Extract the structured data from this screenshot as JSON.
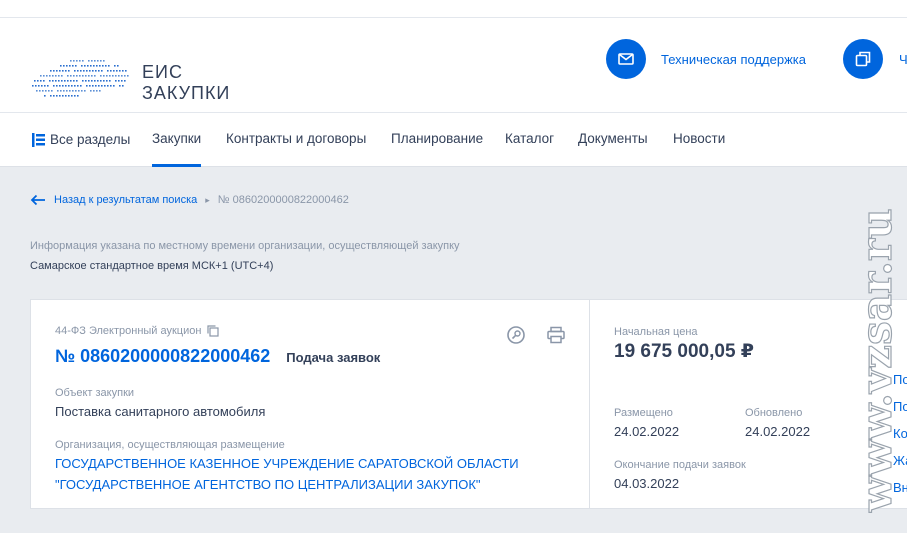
{
  "header": {
    "logo_line1": "ЕИС",
    "logo_line2": "ЗАКУПКИ",
    "support_label": "Техническая поддержка",
    "second_action_label": "Ч"
  },
  "nav": {
    "items": [
      {
        "label": "Все разделы"
      },
      {
        "label": "Закупки"
      },
      {
        "label": "Контракты и договоры"
      },
      {
        "label": "Планирование"
      },
      {
        "label": "Каталог"
      },
      {
        "label": "Документы"
      },
      {
        "label": "Новости"
      }
    ],
    "active_index": 1
  },
  "breadcrumb": {
    "back_label": "Назад к результатам поиска",
    "current": "№ 0860200000822000462"
  },
  "timezone": {
    "note": "Информация указана по местному времени организации, осуществляющей закупку",
    "value": "Самарское стандартное время МСК+1 (UTC+4)"
  },
  "purchase": {
    "law_type": "44-ФЗ Электронный аукцион",
    "reg_number": "№ 0860200000822000462",
    "stage": "Подача заявок",
    "object_label": "Объект закупки",
    "object_value": "Поставка  санитарного автомобиля",
    "org_label": "Организация, осуществляющая размещение",
    "org_line1": "ГОСУДАРСТВЕННОЕ КАЗЕННОЕ УЧРЕЖДЕНИЕ САРАТОВСКОЙ ОБЛАСТИ",
    "org_line2": "\"ГОСУДАРСТВЕННОЕ АГЕНТСТВО ПО ЦЕНТРАЛИЗАЦИИ ЗАКУПОК\""
  },
  "price_block": {
    "price_label": "Начальная цена",
    "price_value": "19 675 000,05 ₽",
    "posted_label": "Размещено",
    "posted_value": "24.02.2022",
    "updated_label": "Обновлено",
    "updated_value": "24.02.2022",
    "deadline_label": "Окончание подачи заявок",
    "deadline_value": "04.03.2022"
  },
  "side_links": [
    "По",
    "По",
    "Ко",
    "Жа",
    "Вн"
  ],
  "watermark": "www.vzsar.ru",
  "colors": {
    "accent": "#0065dd",
    "text": "#334059",
    "muted": "#8a96a8",
    "background": "#e9ecf0"
  }
}
